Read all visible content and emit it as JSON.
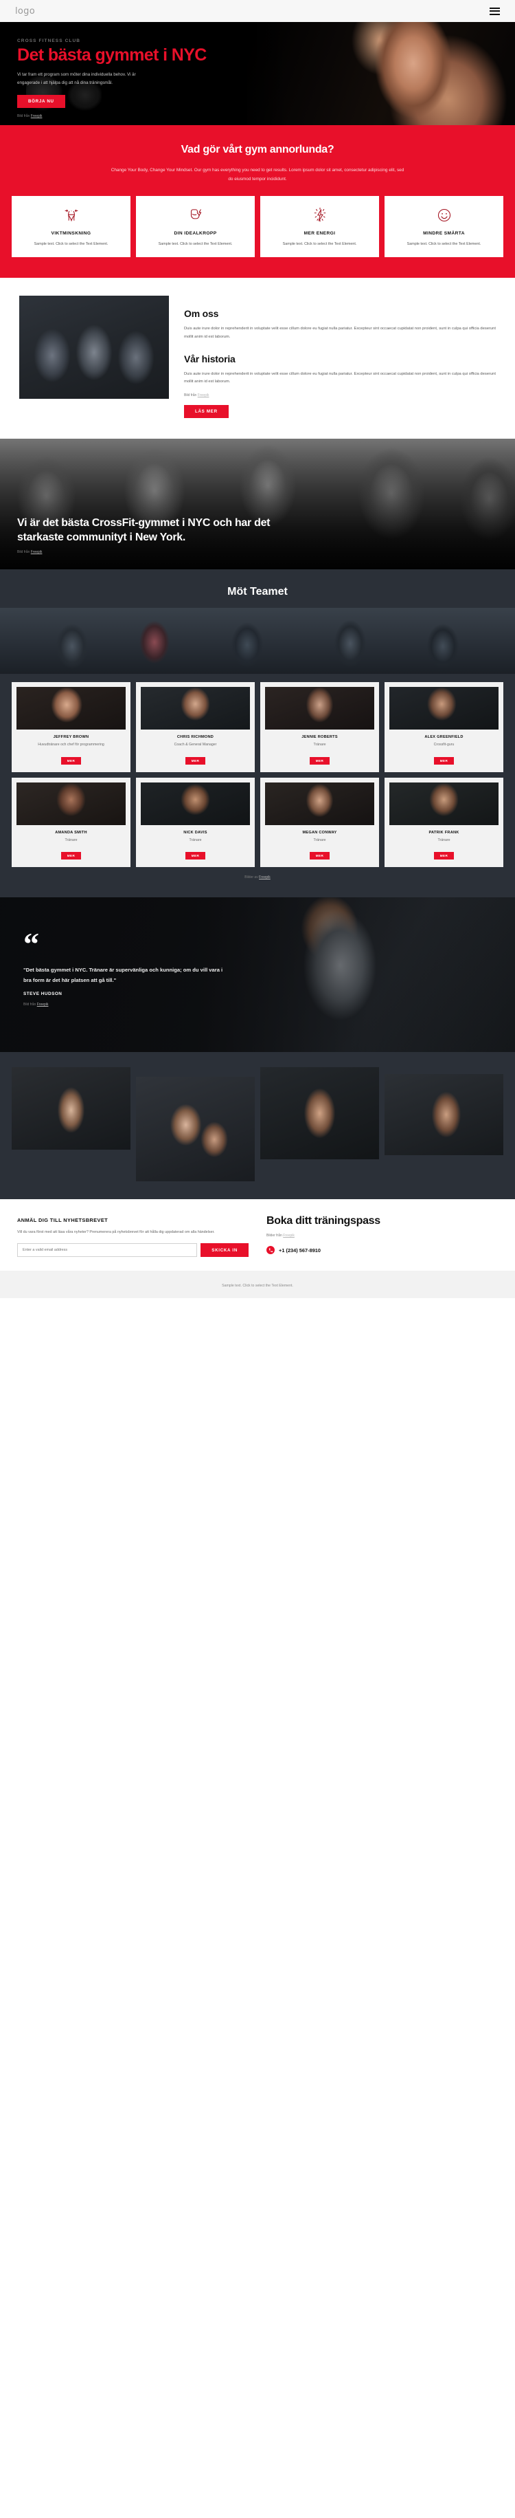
{
  "header": {
    "logo": "logo",
    "menu_icon": "hamburger-menu-icon"
  },
  "hero": {
    "eyebrow": "CROSS FITNESS CLUB",
    "title": "Det bästa gymmet i NYC",
    "paragraph": "Vi tar fram ett program som möter dina individuella behov. Vi är engagerade i att hjälpa dig att nå dina träningsmål.",
    "cta": "BÖRJA NU",
    "credit_prefix": "Bild från ",
    "credit_link": "Freepik"
  },
  "features": {
    "heading": "Vad gör vårt gym annorlunda?",
    "lede": "Change Your Body, Change Your Mindset. Our gym has everything you need to get results. Lorem ipsum dolor sit amet, consectetur adipiscing elit, sed do eiusmod tempor incididunt.",
    "cards": [
      {
        "icon": "waist-measure-icon",
        "title": "VIKTMINSKNING",
        "body": "Sample text. Click to select the Text Element."
      },
      {
        "icon": "flexed-bicep-icon",
        "title": "DIN IDEALKROPP",
        "body": "Sample text. Click to select the Text Element."
      },
      {
        "icon": "lightning-bolt-icon",
        "title": "MER ENERGI",
        "body": "Sample text. Click to select the Text Element."
      },
      {
        "icon": "smiley-face-icon",
        "title": "MINDRE SMÄRTA",
        "body": "Sample text. Click to select the Text Element."
      }
    ]
  },
  "about": {
    "photo": "team-group-photo",
    "heading_1": "Om oss",
    "paragraph_1": "Duis aute irure dolor in reprehenderit in voluptate velit esse cillum dolore eu fugiat nulla pariatur. Excepteur sint occaecat cupidatat non proident, sunt in culpa qui officia deserunt mollit anim id est laborum.",
    "heading_2": "Vår historia",
    "paragraph_2": "Duis aute irure dolor in reprehenderit in voluptate velit esse cillum dolore eu fugiat nulla pariatur. Excepteur sint occaecat cupidatat non proident, sunt in culpa qui officia deserunt mollit anim id est laborum.",
    "credit_prefix": "Bild från ",
    "credit_link": "Freepik",
    "cta": "LÄS MER"
  },
  "band": {
    "heading": "Vi är det bästa CrossFit-gymmet i NYC och har det starkaste communityt i New York.",
    "credit_prefix": "Bild från ",
    "credit_link": "Freepik"
  },
  "team": {
    "heading": "Möt Teamet",
    "hero_photo": "gym-interior-photo",
    "members": [
      {
        "photo": "member-photo-1",
        "name": "JEFFREY BROWN",
        "role": "Huvudtränare och chef för programmering",
        "cta": "MER"
      },
      {
        "photo": "member-photo-2",
        "name": "CHRIS RICHMOND",
        "role": "Coach & General Manager",
        "cta": "MER"
      },
      {
        "photo": "member-photo-3",
        "name": "JENNIE ROBERTS",
        "role": "Tränare",
        "cta": "MER"
      },
      {
        "photo": "member-photo-4",
        "name": "ALEX GREENFIELD",
        "role": "Crossfit-guru",
        "cta": "MER"
      },
      {
        "photo": "member-photo-5",
        "name": "AMANDA SMITH",
        "role": "Tränare",
        "cta": "MER"
      },
      {
        "photo": "member-photo-6",
        "name": "NICK DAVIS",
        "role": "Tränare",
        "cta": "MER"
      },
      {
        "photo": "member-photo-7",
        "name": "MEGAN CONWAY",
        "role": "Tränare",
        "cta": "MER"
      },
      {
        "photo": "member-photo-8",
        "name": "PATRIK FRANK",
        "role": "Tränare",
        "cta": "MER"
      }
    ],
    "credit_prefix": "Bilder av ",
    "credit_link": "Freepik"
  },
  "testimonial": {
    "quote_mark": "“",
    "quote": "\"Det bästa gymmet i NYC. Tränare är supervänliga och kunniga; om du vill vara i bra form är det här platsen att gå till.\"",
    "author": "STEVE HUDSON",
    "credit_prefix": "Bild från ",
    "credit_link": "Freepik"
  },
  "gallery": {
    "images": [
      "gallery-photo-1",
      "gallery-photo-2",
      "gallery-photo-3",
      "gallery-photo-4"
    ]
  },
  "footer": {
    "newsletter_title": "ANMÄL DIG TILL NYHETSBREVET",
    "newsletter_text": "Vill du vara först med att läsa våra nyheter? Prenumerera på nyhetsbrevet för att hålla dig uppdaterad om alla händelser.",
    "email_placeholder": "Enter a valid email address",
    "subscribe_label": "SKICKA IN",
    "booking_title": "Boka ditt träningspass",
    "credit_prefix": "Bilder från ",
    "credit_link": "Freepik",
    "phone_icon": "phone-icon",
    "phone": "+1 (234) 567-8910",
    "bottom_text": "Sample text. Click to select the Text Element."
  },
  "colors": {
    "accent": "#e8102a",
    "dark": "#2b3038",
    "black": "#000000"
  }
}
